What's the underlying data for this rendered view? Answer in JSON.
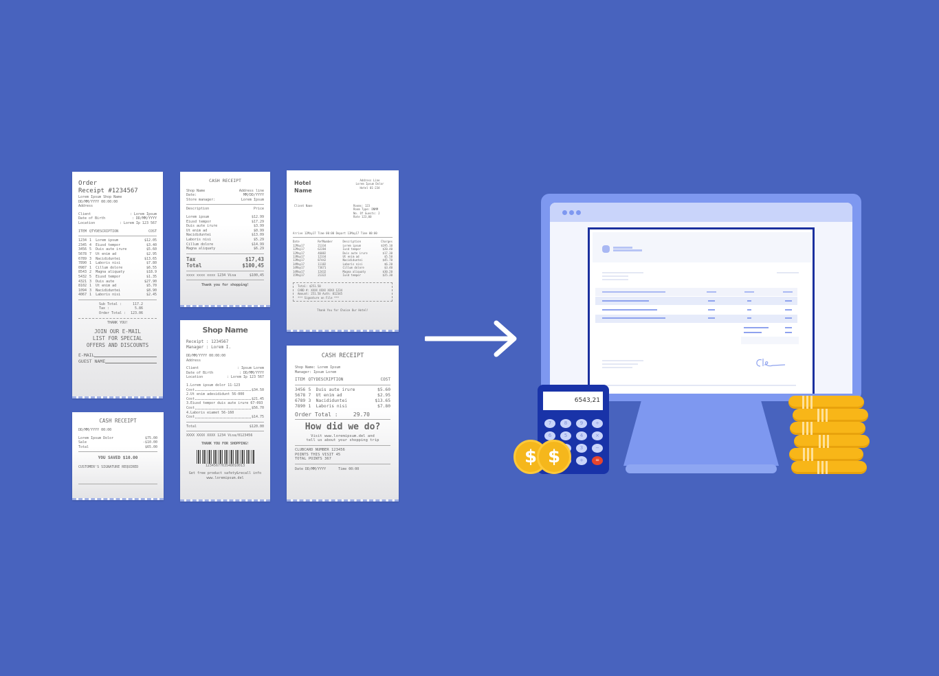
{
  "colors": {
    "background": "#4863be",
    "monitor": "#7e98f0",
    "document_border": "#1a2f9e",
    "calculator": "#1933a8",
    "coin": "#f5b71c"
  },
  "order_receipt": {
    "title": "Order",
    "subtitle": "Receipt #1234567",
    "header": [
      "Lorem Ipsum Shop Name",
      "DD/MM/YYYY 00:00:00",
      "Address"
    ],
    "client": [
      [
        "Client",
        ": Lorem Ipsum"
      ],
      [
        "Date of Birth",
        ": DD/MM/YYYY"
      ],
      [
        "Location",
        ": Lorem Ip 123 567"
      ]
    ],
    "columns": [
      "ITEM",
      "QTY",
      "DESCRIPTION",
      "COST"
    ],
    "items": [
      [
        "1234",
        "1",
        "Lorem ipsum",
        "$12.05"
      ],
      [
        "2345",
        "4",
        "Eiusd tempor",
        "$3.40"
      ],
      [
        "3456",
        "5",
        "Duis aute irure",
        "$5.60"
      ],
      [
        "5678",
        "7",
        "Ut enim ad",
        "$2.95"
      ],
      [
        "6789",
        "3",
        "Nacididuntei",
        "$13.65"
      ],
      [
        "7890",
        "1",
        "Laboris nisi",
        "$7.80"
      ],
      [
        "0987",
        "1",
        "Cillum dolore",
        "$6.55"
      ],
      [
        "8543",
        "2",
        "Magna aliquaty",
        "$18.9"
      ],
      [
        "5432",
        "5",
        "Eiusd tempor",
        "$1.35"
      ],
      [
        "4321",
        "3",
        "Duis aute",
        "$27.90"
      ],
      [
        "8102",
        "1",
        "Ut enim ad",
        "$5.70"
      ],
      [
        "1094",
        "3",
        "Nacididuntei",
        "$8.90"
      ],
      [
        "4067",
        "1",
        "Laboris nisi",
        "$2.45"
      ]
    ],
    "totals": [
      [
        "Sub Total :",
        "117.2"
      ],
      [
        "Tax :",
        "5.86"
      ],
      [
        "Order Total :",
        "123.06"
      ]
    ],
    "thanks": "THANK YOU!",
    "promo": [
      "JOIN OUR E-MAIL",
      "LIST FOR SPECIAL",
      "OFFERS AND DISCOUNTS"
    ],
    "fields": [
      "E-MAIL",
      "GUEST NAME"
    ]
  },
  "cash_receipt_small": {
    "title": "CASH RECEIPT",
    "datetime": "DD/MM/YYYY   00:00",
    "lines": [
      [
        "Lorem Ipsum Dolor",
        "$75.00"
      ],
      [
        "Sale",
        "-$10.00"
      ],
      [
        "Total",
        "$65.00"
      ]
    ],
    "saved": "YOU SAVED $10.00",
    "signature": "CUSTOMER'S SIGNATURE REQUIRED"
  },
  "cash_receipt_price": {
    "title": "CASH RECEIPT",
    "info": [
      [
        "Shop Name",
        "Address line"
      ],
      [
        "Date:",
        "MM/DD/YYYY"
      ],
      [
        "Store manager:",
        "Lorem Ipsum"
      ]
    ],
    "columns": [
      "Description",
      "Price"
    ],
    "items": [
      [
        "Lorem ipsum",
        "$12.99"
      ],
      [
        "Eiusd tempor",
        "$17.29"
      ],
      [
        "Duis aute irure",
        "$3.99"
      ],
      [
        "Ut enim ad",
        "$0.99"
      ],
      [
        "Nacididuntei",
        "$13.09"
      ],
      [
        "Laboris nisi",
        "$5.29"
      ],
      [
        "Cillum dolore",
        "$14.99"
      ],
      [
        "Magna aliquaty",
        "$6.29"
      ]
    ],
    "tax": [
      "Tax",
      "$17,43"
    ],
    "total": [
      "Total",
      "$100,45"
    ],
    "card": [
      "xxxx xxxx xxxx 1234 Visa",
      "$100,45"
    ],
    "thanks": "Thank you for shopping!"
  },
  "shop_receipt": {
    "title": "Shop Name",
    "receipt": "Receipt : 1234567",
    "manager": "Manager : Lorem I.",
    "datetime": "DD/MM/YYYY 00:00:00",
    "address": "Address",
    "client": [
      [
        "Client",
        ": Ipsum Lorem"
      ],
      [
        "Date of Birth",
        ": DD/MM/YYYY"
      ],
      [
        "Location",
        ": Lorem Ip 123 567"
      ]
    ],
    "items": [
      [
        "1.Lorem ipsum dolor 11-123",
        "$34.50"
      ],
      [
        "2.Ut enim adesididunt 56-000",
        "$21.45"
      ],
      [
        "3.Eiusd tempor duis aute irure 67-093",
        "$56.70"
      ],
      [
        "4.Laboris eiamet 56-160",
        "$14.75"
      ]
    ],
    "cost_label": "Cost",
    "total": [
      "Total",
      "$120.00"
    ],
    "card": "XXXX XXXX XXXX 1234 Visa/0123456",
    "thanks": "THANK YOU FOR SHOPPING!",
    "barcode_number": "1234567763548010013",
    "footer": [
      "Get free product safety&recall info",
      "www.loremipsum.del"
    ]
  },
  "hotel_receipt": {
    "title": [
      "Hotel",
      "Name"
    ],
    "address": [
      "Address Line",
      "Lorem Ipsum Dolor",
      "Hotel 01-234"
    ],
    "client": "Client Name",
    "room": [
      "Rooms: 123",
      "Room Type: DNMM",
      "No. Of Guests: 2",
      "Rate 123,00"
    ],
    "stay": "Arrive 12May17 Time 00:00 Depart 13May17 Time 00:00",
    "columns": [
      "Date",
      "RefNumber",
      "Description",
      "Charges"
    ],
    "rows": [
      [
        "12May17",
        "21334",
        "Lorem ipsum",
        "$195.10"
      ],
      [
        "12May17",
        "62284",
        "Iusd tempor",
        "$20.40"
      ],
      [
        "12May17",
        "46082",
        "Duis aute irure",
        "$17.30"
      ],
      [
        "13May17",
        "12334",
        "Ut enim ad",
        "$5.50"
      ],
      [
        "13May17",
        "87442",
        "Nacididuntei",
        "$45.70"
      ],
      [
        "14May17",
        "11182",
        "Laboris nisi",
        "$6.20"
      ],
      [
        "14May17",
        "73671",
        "Cillum dolore",
        "$3.40"
      ],
      [
        "14May17",
        "12432",
        "Magna aliquaty",
        "$30.20"
      ],
      [
        "15May17",
        "21322",
        "Iusd tempor",
        "$25.30"
      ]
    ],
    "summary": [
      "Total: $251.50",
      "CARD #: XXXX XXXX XXXX 1234",
      "Amount: 251.50   Auth: 012345",
      "*** Signature on File ***"
    ],
    "thanks": "Thank You for Choice Our Hotel!"
  },
  "cash_receipt_survey": {
    "title": "CASH RECEIPT",
    "shop": "Shop Name: Lorem Ipsum",
    "manager": "Manager: Ipsum Lorem",
    "columns": [
      "ITEM",
      "QTY",
      "DESCRIPTION",
      "COST"
    ],
    "items": [
      [
        "3456",
        "5",
        "Duis aute irure",
        "$5.60"
      ],
      [
        "5678",
        "7",
        "Ut enim ad",
        "$2.95"
      ],
      [
        "6789",
        "3",
        "Nacididuntei",
        "$13.65"
      ],
      [
        "7890",
        "1",
        "Laboris nisi",
        "$7.80"
      ]
    ],
    "total": [
      "Order Total :",
      "29.70"
    ],
    "heading": "How did we do?",
    "visit": [
      "Visit www.loremipsum.del and",
      "tell us about your shopping trip"
    ],
    "club": [
      "CLUBCARD NUMBER 123456",
      "POINTS THIS VISIT 45",
      "TOTAL POINTS 367"
    ],
    "footer": [
      "Date DD/MM/YYYY",
      "Time 00:00"
    ]
  },
  "calculator": {
    "display": "6543,21",
    "keys": [
      "7",
      "8",
      "9",
      "÷",
      "6",
      "5",
      "4",
      "×",
      "3",
      "−",
      "+",
      "="
    ]
  },
  "coins": [
    "$",
    "$"
  ],
  "icons": [
    "arrow-right-icon",
    "monitor-icon",
    "invoice-document-icon",
    "calculator-icon",
    "dollar-coin-icon",
    "coin-stack-icon",
    "signature-icon"
  ]
}
